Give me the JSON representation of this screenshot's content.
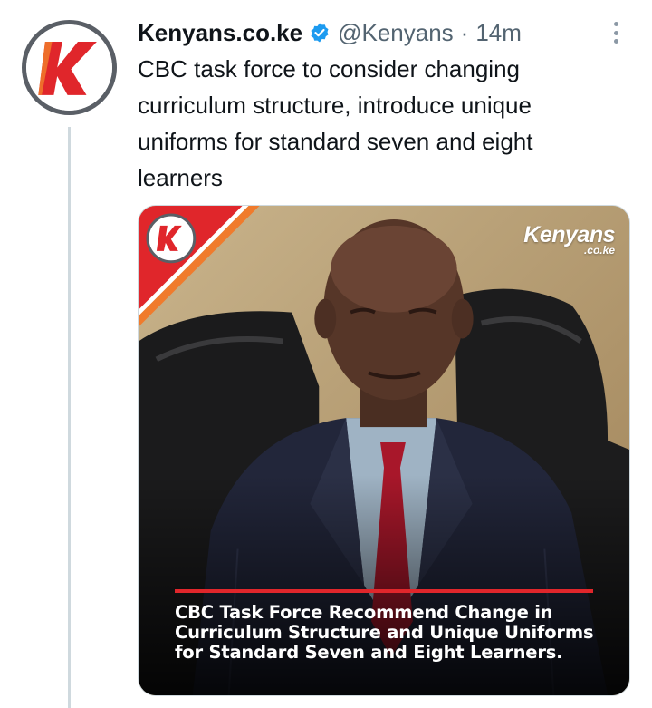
{
  "tweet": {
    "display_name": "Kenyans.co.ke",
    "handle": "@Kenyans",
    "separator": "·",
    "time": "14m",
    "text_lines": [
      "CBC task force to consider changing",
      "curriculum structure, introduce unique",
      "uniforms for standard seven and eight",
      "learners"
    ]
  },
  "media": {
    "brand": {
      "main": "Kenyans",
      "sub": ".co.ke"
    },
    "caption_lines": [
      "CBC Task Force Recommend Change in",
      "Curriculum Structure and Unique Uniforms",
      "for Standard Seven and Eight Learners."
    ]
  },
  "colors": {
    "brand_red": "#e0262b",
    "verified_blue": "#1d9bf0",
    "text_secondary": "#536471",
    "thread_line": "#cfd9de"
  },
  "icons": {
    "avatar": "kenyans-logo-icon",
    "verified": "verified-badge-icon",
    "more": "more-vertical-icon"
  }
}
